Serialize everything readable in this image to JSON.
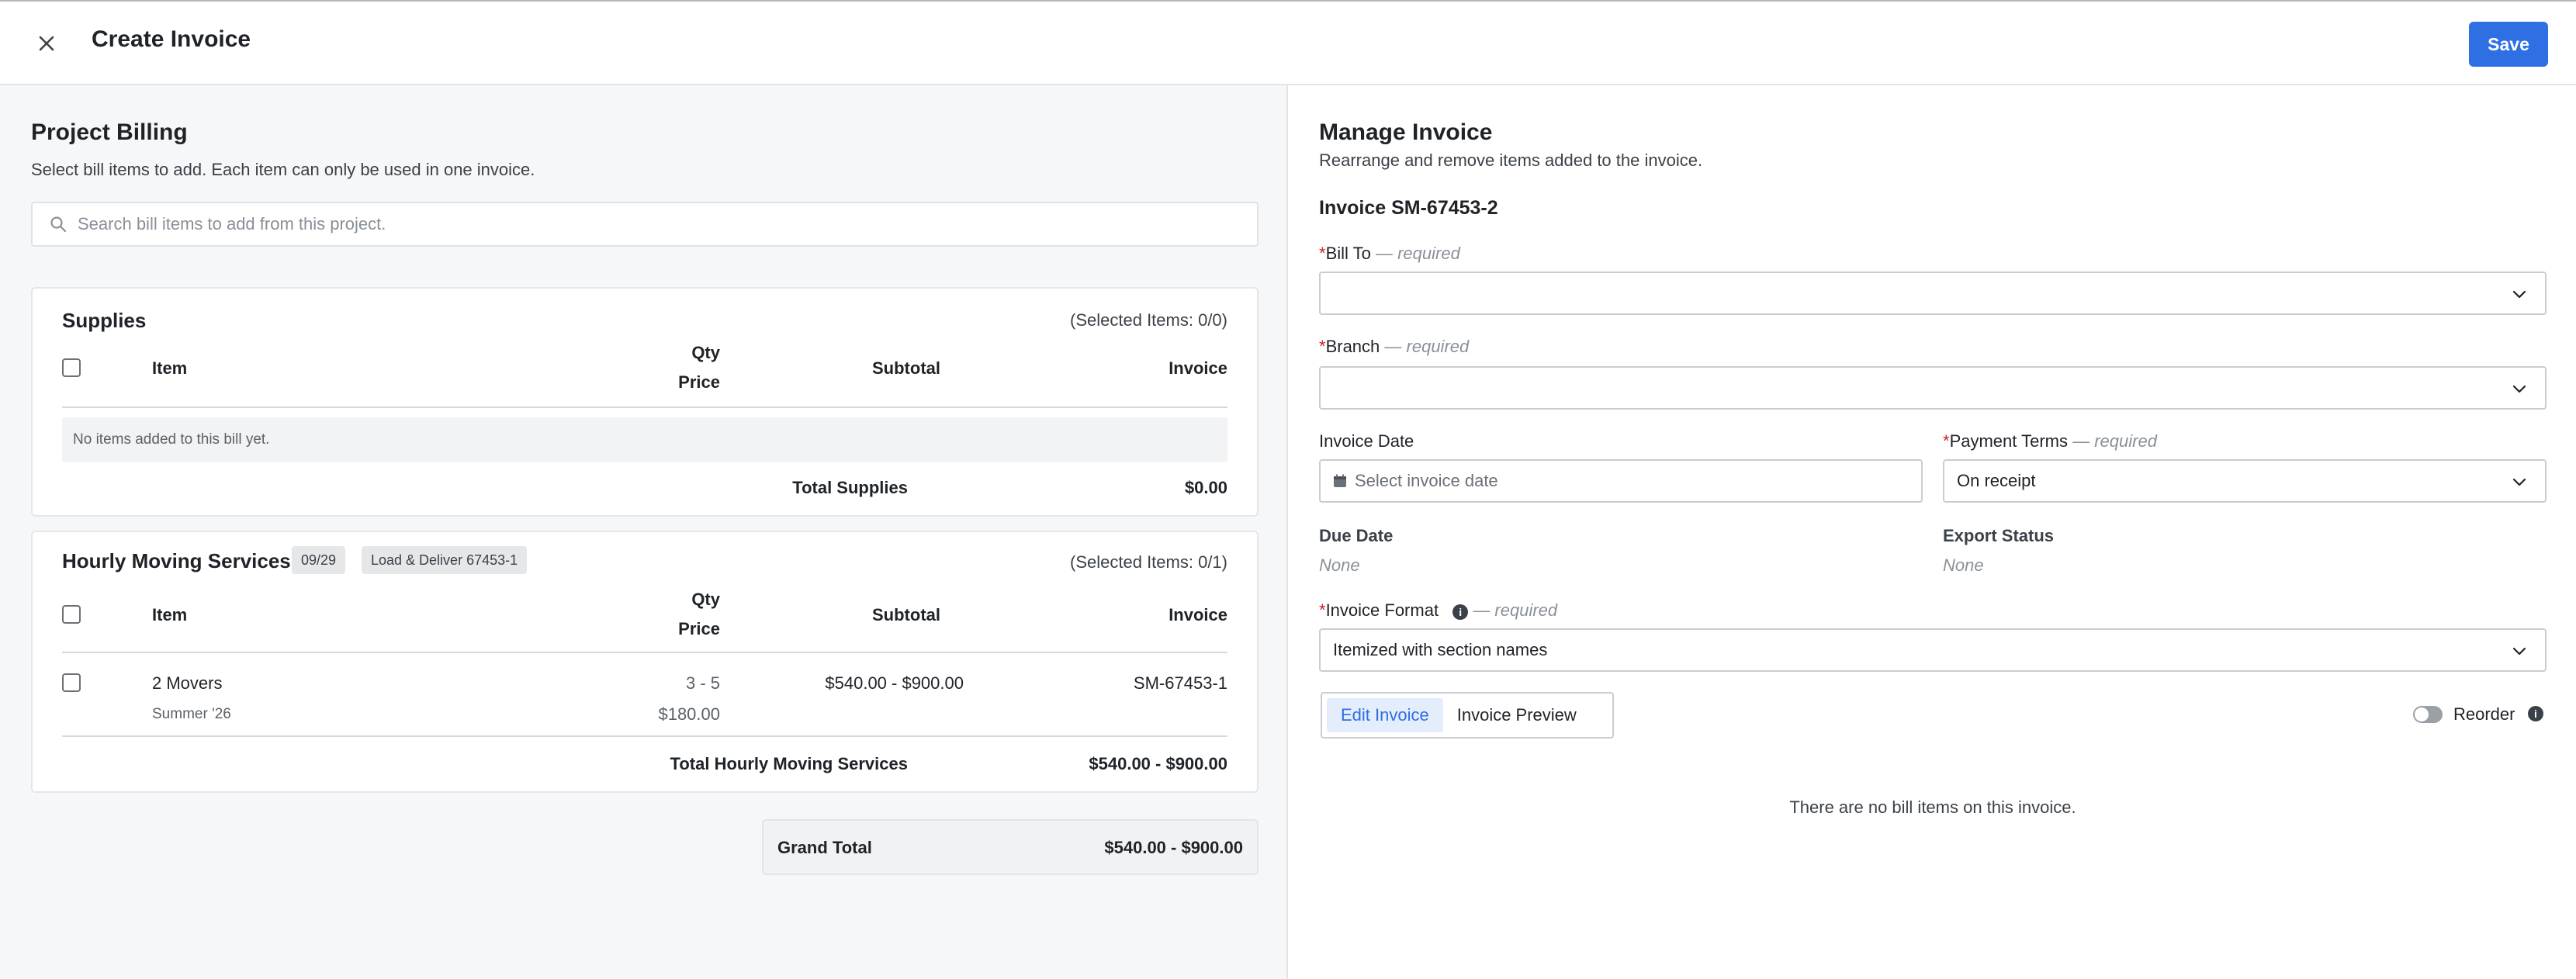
{
  "header": {
    "title": "Create Invoice",
    "save_label": "Save"
  },
  "project_billing": {
    "title": "Project Billing",
    "subtitle": "Select bill items to add. Each item can only be used in one invoice.",
    "search_placeholder": "Search bill items to add from this project.",
    "columns": {
      "item": "Item",
      "qty": "Qty",
      "price": "Price",
      "subtotal": "Subtotal",
      "invoice": "Invoice"
    },
    "sections": [
      {
        "title": "Supplies",
        "selected": "(Selected Items: 0/0)",
        "empty_text": "No items added to this bill yet.",
        "total_label": "Total Supplies",
        "total_value": "$0.00"
      },
      {
        "title": "Hourly Moving Services",
        "badges": [
          "09/29",
          "Load & Deliver 67453-1"
        ],
        "selected": "(Selected Items: 0/1)",
        "rows": [
          {
            "item": "2 Movers",
            "item_sub": "Summer '26",
            "qty": "3 - 5",
            "price": "$180.00",
            "subtotal": "$540.00 - $900.00",
            "invoice": "SM-67453-1"
          }
        ],
        "total_label": "Total Hourly Moving Services",
        "total_value": "$540.00 - $900.00"
      }
    ],
    "grand_total_label": "Grand Total",
    "grand_total_value": "$540.00 - $900.00"
  },
  "manage_invoice": {
    "title": "Manage Invoice",
    "subtitle": "Rearrange and remove items added to the invoice.",
    "invoice_id": "Invoice SM-67453-2",
    "required_note": "— required",
    "bill_to_label": "Bill To",
    "bill_to_value": "",
    "branch_label": "Branch",
    "branch_value": "",
    "invoice_date_label": "Invoice Date",
    "invoice_date_placeholder": "Select invoice date",
    "payment_terms_label": "Payment Terms",
    "payment_terms_value": "On receipt",
    "due_date_label": "Due Date",
    "due_date_value": "None",
    "export_status_label": "Export Status",
    "export_status_value": "None",
    "invoice_format_label": "Invoice Format",
    "invoice_format_value": "Itemized with section names",
    "tabs": [
      "Edit Invoice",
      "Invoice Preview"
    ],
    "reorder_label": "Reorder",
    "empty_text": "There are no bill items on this invoice."
  },
  "colors": {
    "accent": "#2f6fe4",
    "required": "#c7252b"
  },
  "icons": {
    "close": "close-icon",
    "search": "search-icon",
    "calendar": "calendar-icon",
    "chevron": "chevron-down-icon",
    "info": "info-icon"
  }
}
